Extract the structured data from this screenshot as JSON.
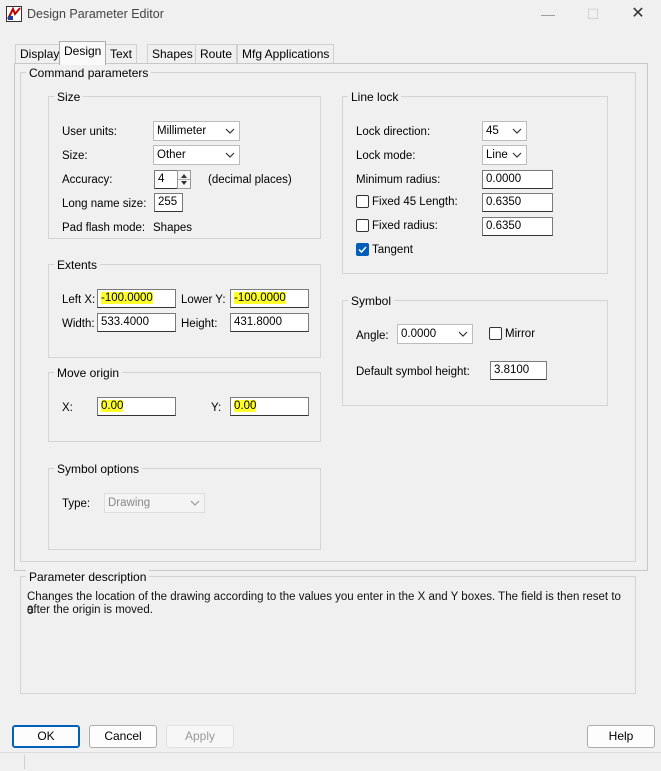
{
  "window": {
    "title": "Design Parameter Editor"
  },
  "tabs": [
    {
      "label": "Display"
    },
    {
      "label": "Design",
      "active": true
    },
    {
      "label": "Text"
    },
    {
      "label": "Shapes"
    },
    {
      "label": "Route"
    },
    {
      "label": "Mfg Applications"
    }
  ],
  "command_parameters": {
    "legend": "Command parameters",
    "size": {
      "legend": "Size",
      "user_units_label": "User units:",
      "user_units_value": "Millimeter",
      "size_label": "Size:",
      "size_value": "Other",
      "accuracy_label": "Accuracy:",
      "accuracy_value": "4",
      "accuracy_suffix": "(decimal places)",
      "long_name_label": "Long name size:",
      "long_name_value": "255",
      "pad_flash_label": "Pad flash mode:",
      "pad_flash_value": "Shapes"
    },
    "extents": {
      "legend": "Extents",
      "left_x_label": "Left X:",
      "left_x_value": "-100.0000",
      "lower_y_label": "Lower Y:",
      "lower_y_value": "-100.0000",
      "width_label": "Width:",
      "width_value": "533.4000",
      "height_label": "Height:",
      "height_value": "431.8000"
    },
    "move_origin": {
      "legend": "Move origin",
      "x_label": "X:",
      "x_value": "0.00",
      "y_label": "Y:",
      "y_value": "0.00"
    },
    "symbol_options": {
      "legend": "Symbol options",
      "type_label": "Type:",
      "type_value": "Drawing"
    },
    "line_lock": {
      "legend": "Line lock",
      "lock_direction_label": "Lock direction:",
      "lock_direction_value": "45",
      "lock_mode_label": "Lock mode:",
      "lock_mode_value": "Line",
      "min_radius_label": "Minimum radius:",
      "min_radius_value": "0.0000",
      "fixed45_label": "Fixed 45 Length:",
      "fixed45_value": "0.6350",
      "fixed45_checked": false,
      "fixed_radius_label": "Fixed radius:",
      "fixed_radius_value": "0.6350",
      "fixed_radius_checked": false,
      "tangent_label": "Tangent",
      "tangent_checked": true
    },
    "symbol": {
      "legend": "Symbol",
      "angle_label": "Angle:",
      "angle_value": "0.0000",
      "mirror_label": "Mirror",
      "mirror_checked": false,
      "default_height_label": "Default symbol height:",
      "default_height_value": "3.8100"
    }
  },
  "parameter_description": {
    "legend": "Parameter description",
    "line1": "Changes the location of the drawing according to the values you enter in the X and Y boxes. The field is then reset to 0",
    "line2": "after the origin is moved."
  },
  "buttons": {
    "ok": "OK",
    "cancel": "Cancel",
    "apply": "Apply",
    "help": "Help"
  },
  "colors": {
    "highlight": "#ffff2a",
    "accent": "#005fb8",
    "background": "#f0f0f0"
  }
}
